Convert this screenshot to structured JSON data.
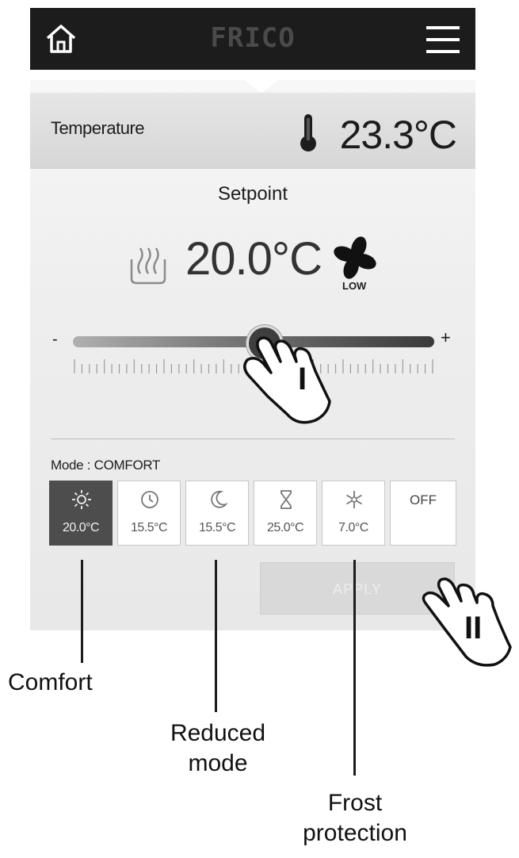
{
  "header": {
    "brand": "FRICO",
    "home_icon": "home-icon",
    "menu_icon": "menu-icon"
  },
  "temperature": {
    "label": "Temperature",
    "value": "23.3°C",
    "icon": "thermometer-icon"
  },
  "setpoint": {
    "label": "Setpoint",
    "value": "20.0°C",
    "heater_icon": "heater-icon",
    "fan_icon": "fan-icon",
    "fan_speed": "LOW"
  },
  "slider": {
    "minus": "-",
    "plus": "+",
    "level": 0.53
  },
  "mode": {
    "label": "Mode : COMFORT",
    "tiles": [
      {
        "icon": "sun-icon",
        "value": "20.0°C",
        "active": true
      },
      {
        "icon": "clock-icon",
        "value": "15.5°C",
        "active": false
      },
      {
        "icon": "moon-icon",
        "value": "15.5°C",
        "active": false
      },
      {
        "icon": "hourglass-icon",
        "value": "25.0°C",
        "active": false
      },
      {
        "icon": "snowflake-icon",
        "value": "7.0°C",
        "active": false
      },
      {
        "label": "OFF",
        "active": false
      }
    ]
  },
  "apply": {
    "label": "APPLY"
  },
  "callouts": {
    "comfort": "Comfort",
    "reduced_1": "Reduced",
    "reduced_2": "mode",
    "frost_1": "Frost",
    "frost_2": "protection",
    "step_1": "I",
    "step_2": "II"
  },
  "colors": {
    "header_bg": "#1c1c1c",
    "active_tile": "#4d4d4d",
    "apply_bg": "#d9d9d9"
  }
}
